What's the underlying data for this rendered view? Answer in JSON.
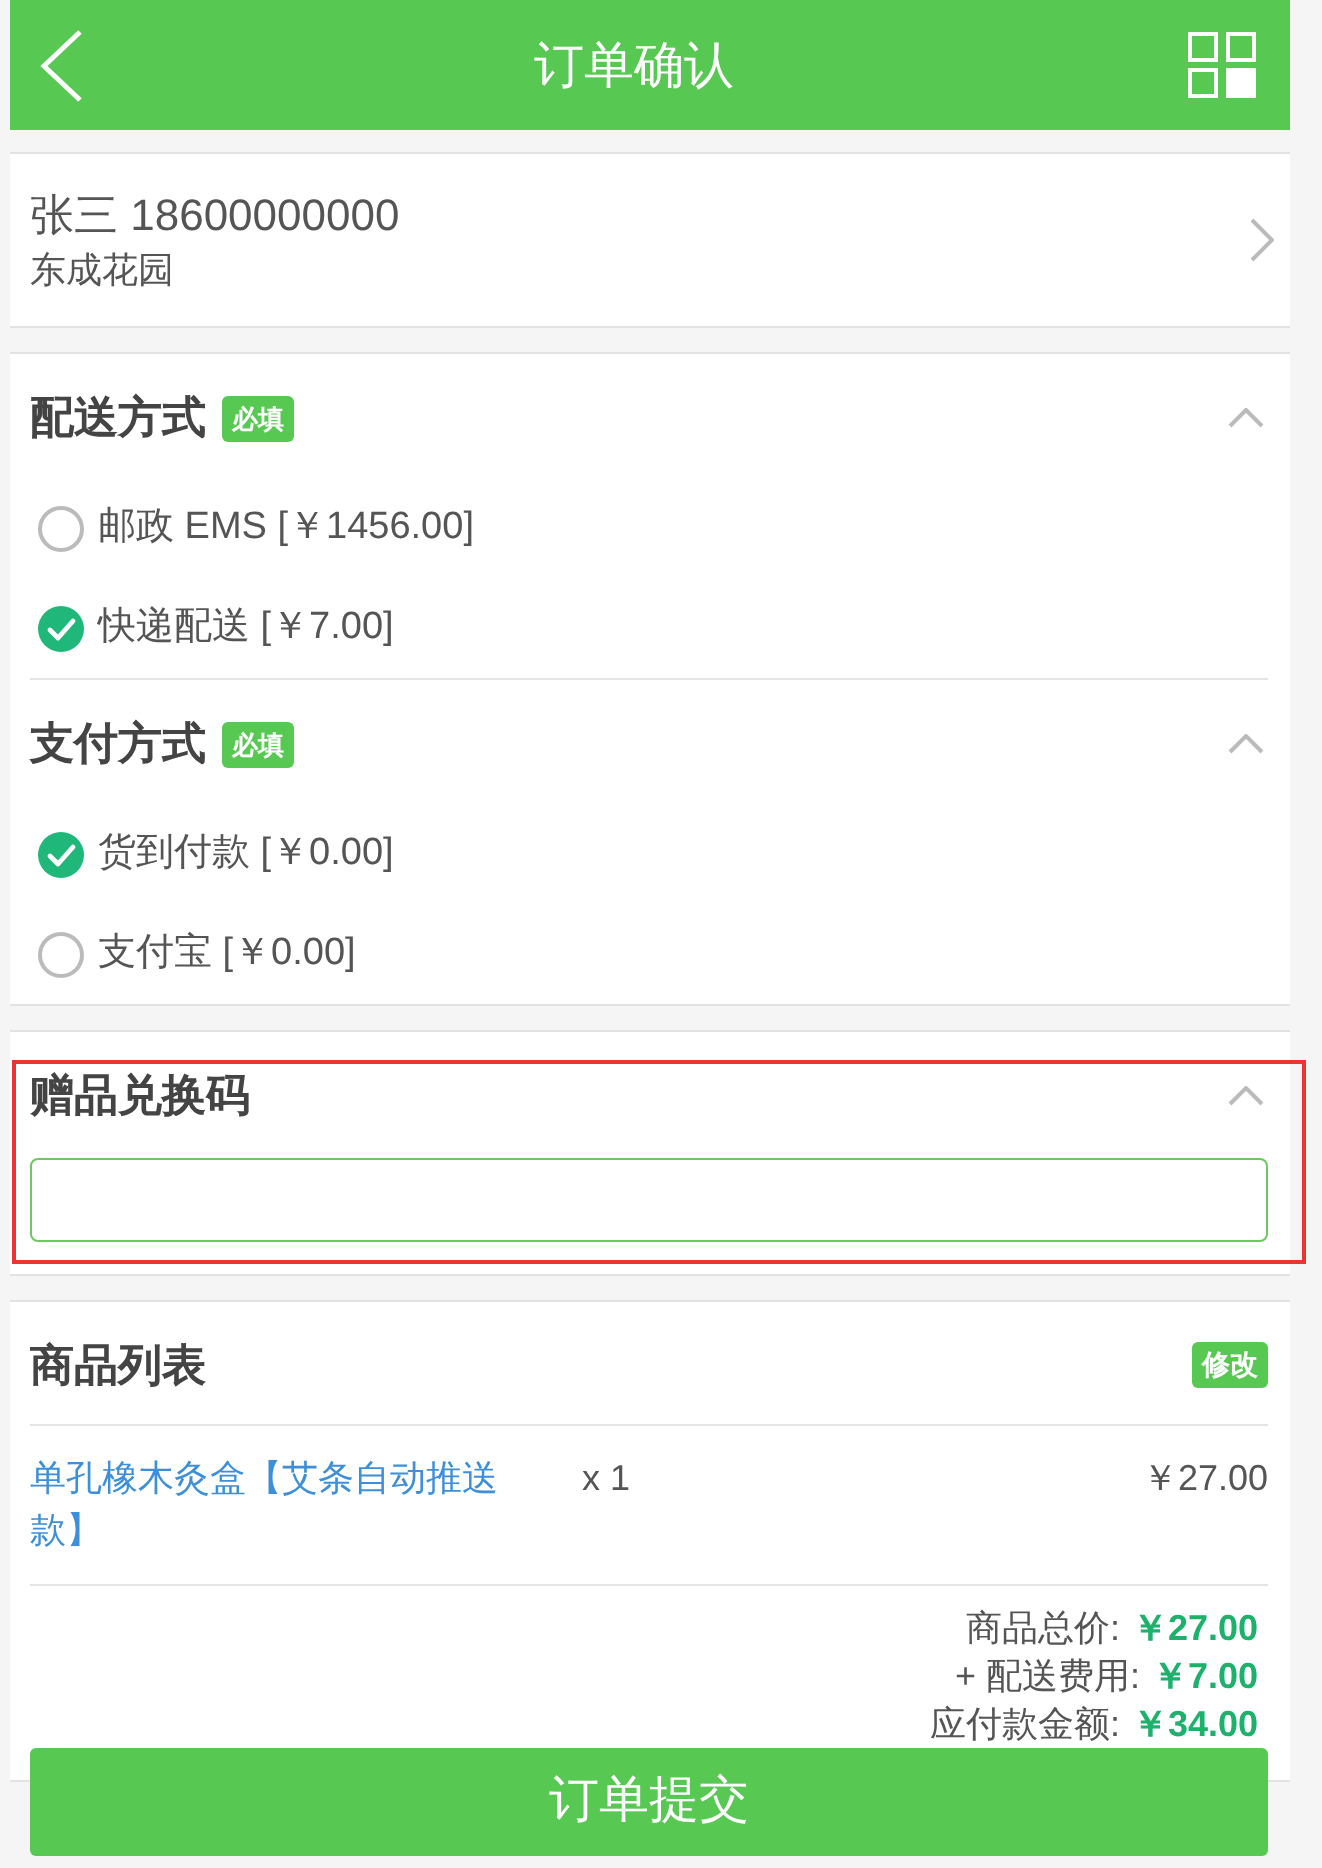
{
  "header": {
    "title": "订单确认"
  },
  "address": {
    "contact": "张三 18600000000",
    "location": "东成花园"
  },
  "sections": [
    {
      "title": "配送方式",
      "badge": "必填",
      "expanded": true,
      "options": [
        {
          "label": "邮政 EMS [￥1456.00]",
          "selected": false
        },
        {
          "label": "快递配送 [￥7.00]",
          "selected": true
        }
      ]
    },
    {
      "title": "支付方式",
      "badge": "必填",
      "expanded": true,
      "options": [
        {
          "label": "货到付款 [￥0.00]",
          "selected": true
        },
        {
          "label": "支付宝 [￥0.00]",
          "selected": false
        }
      ]
    }
  ],
  "gift_code": {
    "title": "赠品兑换码",
    "expanded": true,
    "highlighted": true
  },
  "products": {
    "title": "商品列表",
    "edit_label": "修改",
    "items": [
      {
        "name": "单孔橡木灸盒【艾条自动推送款】",
        "quantity": "x 1",
        "price": "￥27.00"
      }
    ],
    "totals": [
      {
        "label": "商品总价:",
        "value": "￥27.00"
      },
      {
        "label": "+ 配送费用:",
        "value": "￥7.00"
      },
      {
        "label": "应付款金额:",
        "value": "￥34.00"
      }
    ]
  },
  "submit_button": {
    "label": "订单提交"
  }
}
